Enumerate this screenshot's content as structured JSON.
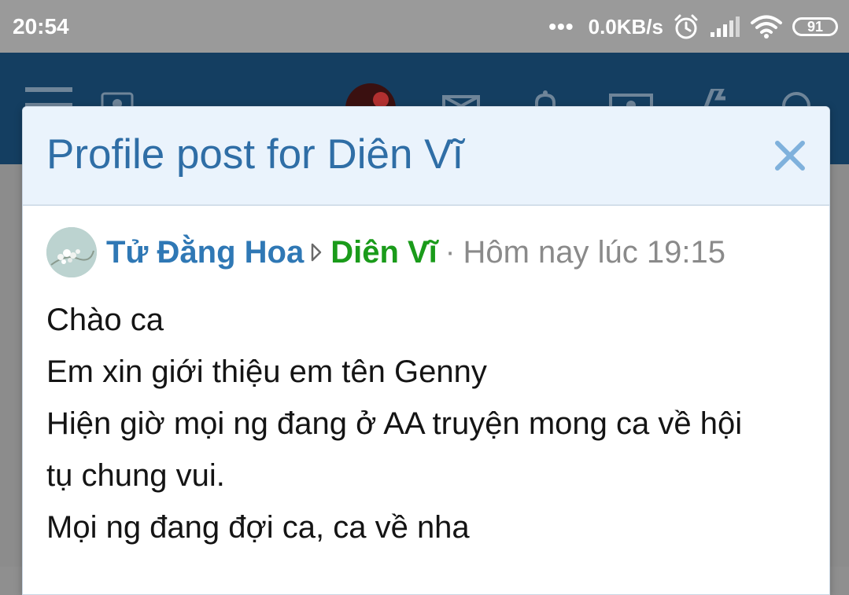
{
  "status_bar": {
    "time": "20:54",
    "more": "•••",
    "net_speed": "0.0KB/s",
    "battery": "91"
  },
  "app_header": {
    "icons": [
      "menu-icon",
      "logo-icon",
      "user-avatar",
      "mail-icon",
      "bell-icon",
      "profile-card-icon",
      "lightning-icon",
      "search-icon"
    ]
  },
  "modal": {
    "title": "Profile post for Diên Vĩ",
    "close_icon": "close-icon"
  },
  "post": {
    "author": "Tử Đằng Hoa",
    "recipient": "Diên Vĩ",
    "separator": "·",
    "time": "Hôm nay lúc 19:15",
    "lines": [
      "Chào ca",
      "Em xin giới thiệu em tên Genny",
      "Hiện giờ mọi ng đang ở AA truyện mong ca về hội",
      "tụ chung vui.",
      "Mọi ng đang đợi ca, ca về nha"
    ]
  },
  "colors": {
    "header_bg": "#143e61",
    "modal_header_bg": "#eaf3fc",
    "title": "#2f6ea6",
    "author": "#2f78b5",
    "recipient": "#1a9b1a",
    "muted": "#8a8a8a"
  }
}
